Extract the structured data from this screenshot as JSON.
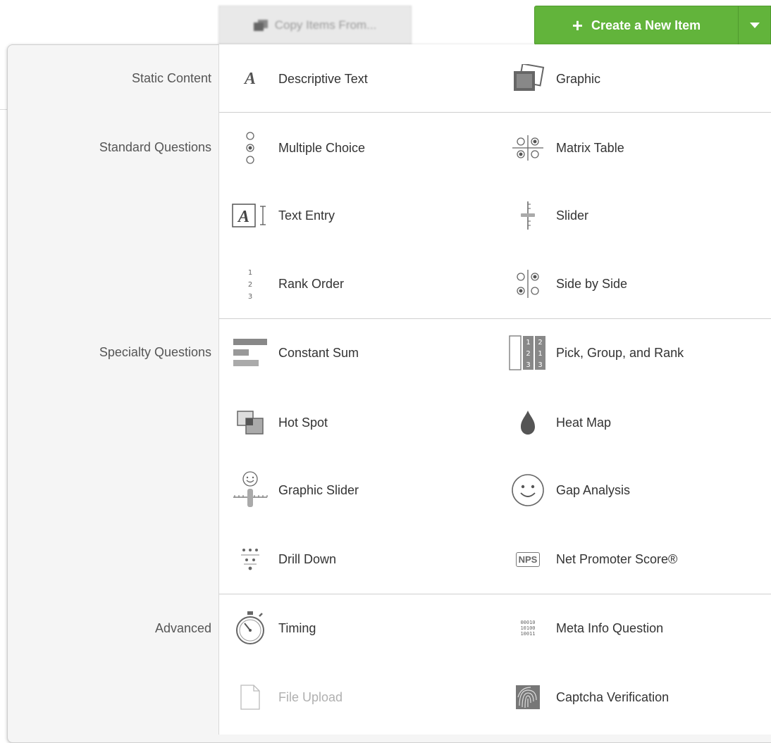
{
  "toolbar": {
    "copy_label": "Copy Items From...",
    "create_label": "Create a New Item",
    "accent": "#62b43b"
  },
  "categories": {
    "static": "Static Content",
    "standard": "Standard Questions",
    "specialty": "Specialty Questions",
    "advanced": "Advanced"
  },
  "items": {
    "descriptive_text": "Descriptive Text",
    "graphic": "Graphic",
    "multiple_choice": "Multiple Choice",
    "matrix_table": "Matrix Table",
    "text_entry": "Text Entry",
    "slider": "Slider",
    "rank_order": "Rank Order",
    "side_by_side": "Side by Side",
    "constant_sum": "Constant Sum",
    "pick_group_rank": "Pick, Group, and Rank",
    "hot_spot": "Hot Spot",
    "heat_map": "Heat Map",
    "graphic_slider": "Graphic Slider",
    "gap_analysis": "Gap Analysis",
    "drill_down": "Drill Down",
    "net_promoter": "Net Promoter Score®",
    "timing": "Timing",
    "meta_info": "Meta Info Question",
    "file_upload": "File Upload",
    "captcha": "Captcha Verification"
  },
  "icons": {
    "descriptive_text": "A",
    "text_entry": "A",
    "nps": "NPS",
    "rank_1": "1",
    "rank_2": "2",
    "rank_3": "3",
    "pgr_1": "1",
    "pgr_2": "2",
    "pgr_3": "2",
    "pgr_4": "1",
    "pgr_5": "3",
    "pgr_6": "3",
    "binary_1": "00010",
    "binary_2": "10100",
    "binary_3": "10011"
  }
}
